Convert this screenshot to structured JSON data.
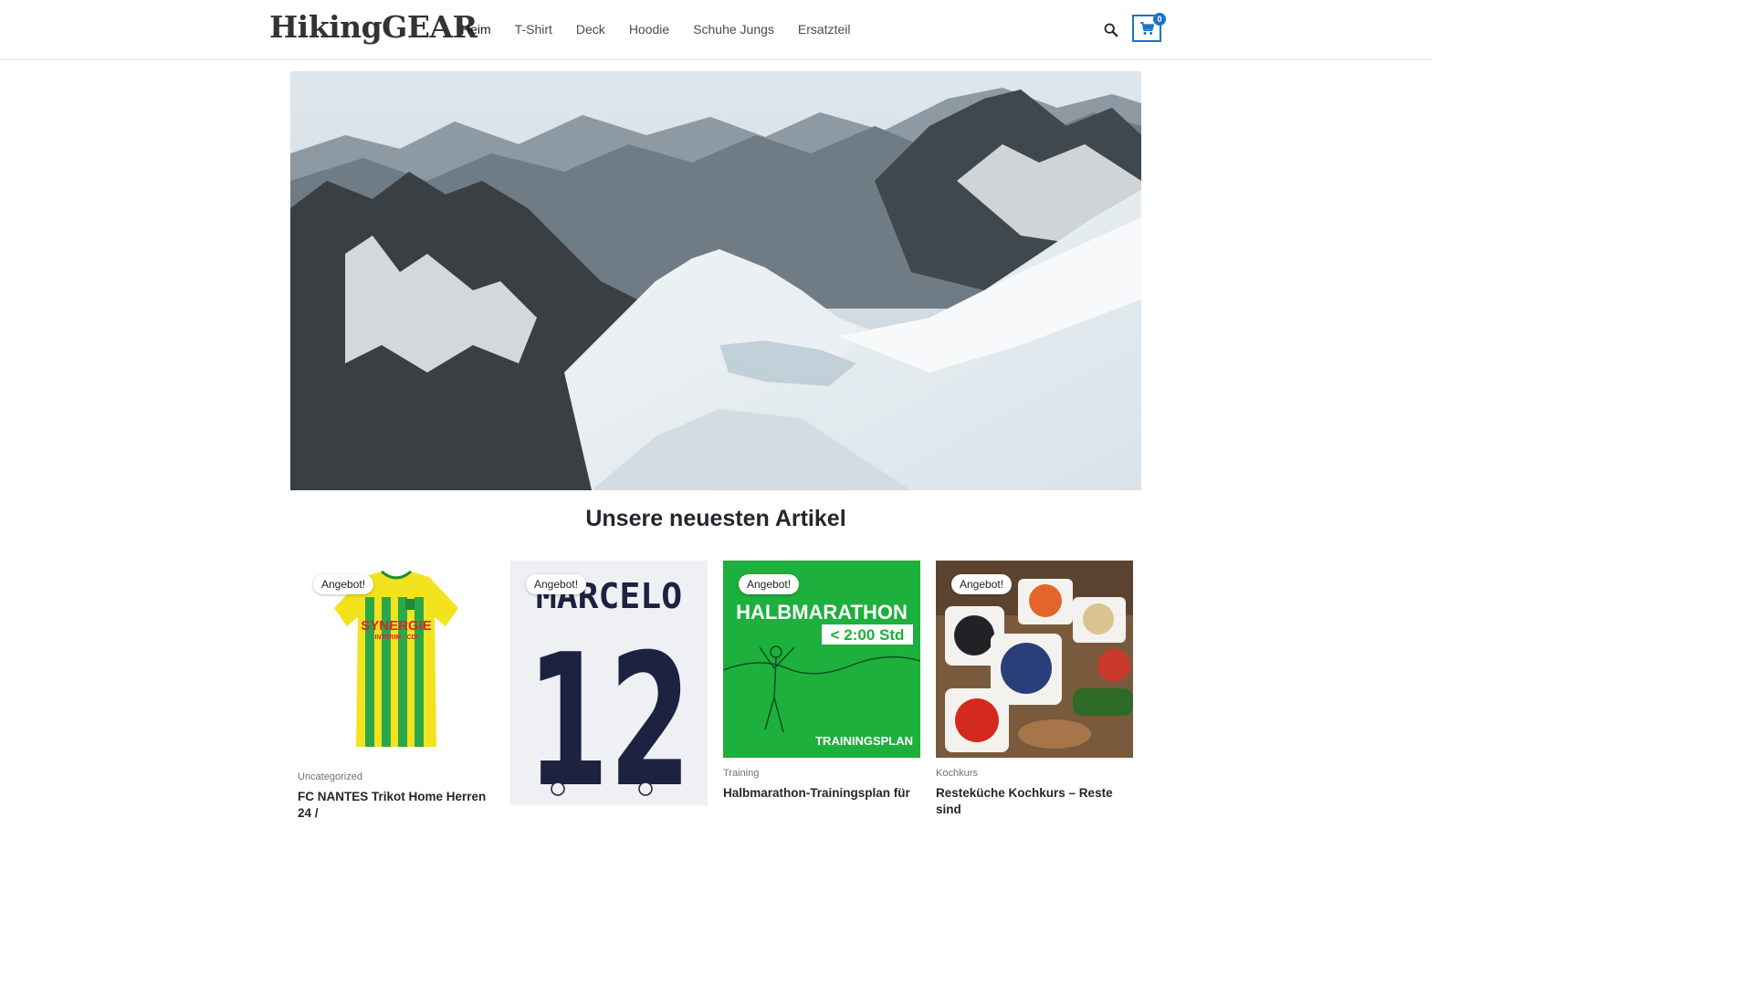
{
  "header": {
    "logo": "HikingGEAR",
    "nav": [
      "Heim",
      "T-Shirt",
      "Deck",
      "Hoodie",
      "Schuhe Jungs",
      "Ersatzteil"
    ],
    "cart_count": "0"
  },
  "section_title": "Unsere neuesten Artikel",
  "products": [
    {
      "badge": "Angebot!",
      "category": "Uncategorized",
      "title": "FC NANTES Trikot Home Herren 24 /",
      "image_text": "SYNERGIE INTERIM - CDI"
    },
    {
      "badge": "Angebot!",
      "category": "",
      "title": "",
      "image_text": "MARCELO 12"
    },
    {
      "badge": "Angebot!",
      "category": "Training",
      "title": "Halbmarathon-Trainingsplan für",
      "image_text": "HALBMARATHON < 2:00 Std TRAININGSPLAN"
    },
    {
      "badge": "Angebot!",
      "category": "Kochkurs",
      "title": "Resteküche Kochkurs – Reste sind",
      "image_text": ""
    }
  ],
  "colors": {
    "accent": "#1a73c9",
    "green_card": "#1db03c"
  }
}
